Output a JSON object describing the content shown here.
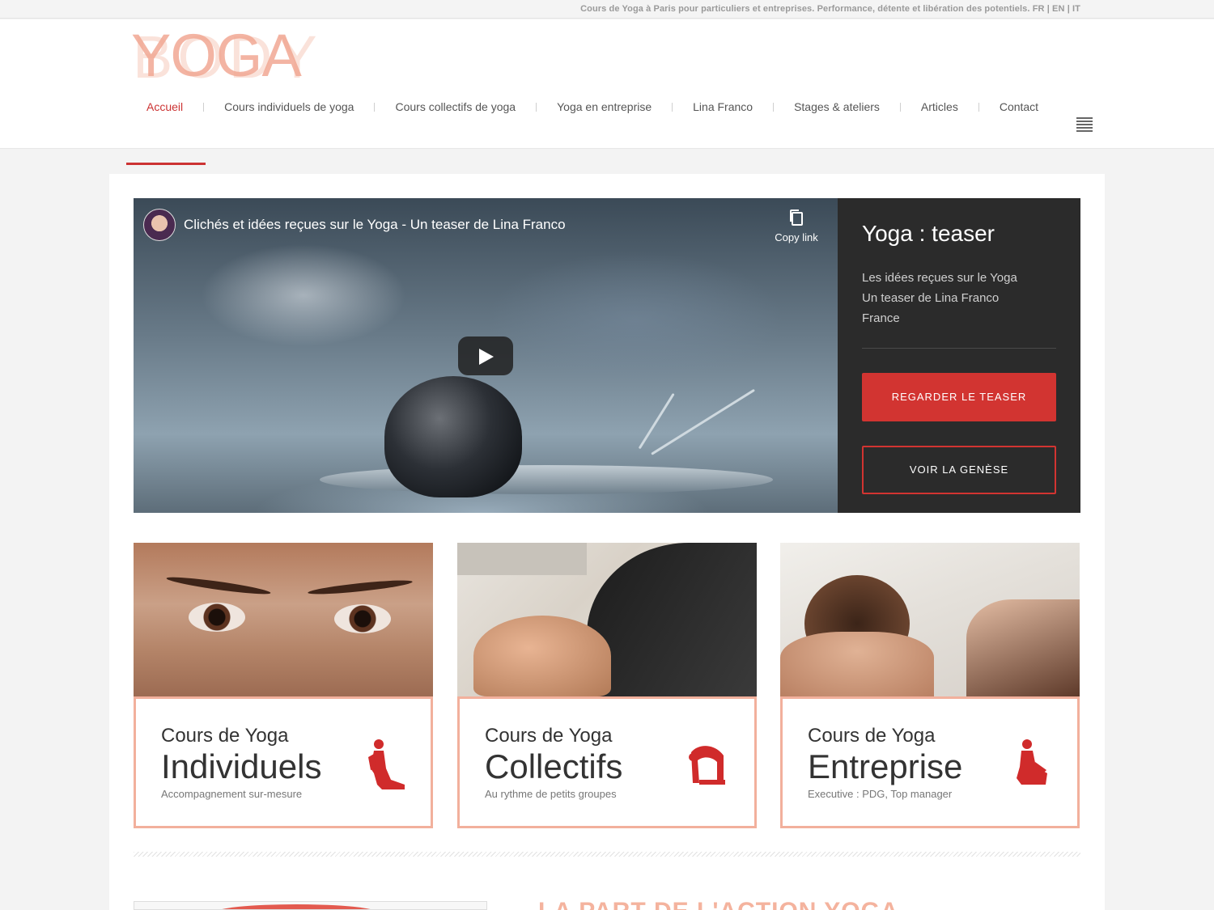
{
  "topbar": {
    "text": "Cours de Yoga à Paris pour particuliers et entreprises. Performance, détente et libération des potentiels. FR | EN | IT"
  },
  "logo": {
    "text": "YOGA",
    "back_text": "BODY"
  },
  "nav": {
    "items": [
      {
        "label": "Accueil",
        "active": true
      },
      {
        "label": "Cours individuels de yoga"
      },
      {
        "label": "Cours collectifs de yoga"
      },
      {
        "label": "Yoga en entreprise"
      },
      {
        "label": "Lina Franco"
      },
      {
        "label": "Stages & ateliers"
      },
      {
        "label": "Articles"
      },
      {
        "label": "Contact"
      }
    ],
    "menu_icon": "menu-icon",
    "accent_color": "#cc3333"
  },
  "video": {
    "title": "Clichés et idées reçues sur le Yoga - Un teaser de Lina Franco",
    "copy_link_label": "Copy link",
    "play_icon": "play-icon"
  },
  "side": {
    "title": "Yoga : teaser",
    "description": [
      "Les idées reçues sur le Yoga",
      "Un teaser de Lina Franco",
      "France"
    ],
    "primary_button": "REGARDER LE TEASER",
    "secondary_button": "VOIR LA GENÈSE",
    "button_color": "#d23431"
  },
  "cards": [
    {
      "pre": "Cours de Yoga",
      "main": "Individuels",
      "sub": "Accompagnement sur-mesure",
      "icon": "yoga-seated-pose-icon"
    },
    {
      "pre": "Cours de Yoga",
      "main": "Collectifs",
      "sub": "Au rythme de petits groupes",
      "icon": "yoga-camel-pose-icon"
    },
    {
      "pre": "Cours de Yoga",
      "main": "Entreprise",
      "sub": "Executive : PDG, Top manager",
      "icon": "yoga-twist-pose-icon"
    }
  ],
  "bottom": {
    "title": "LA PART DE L'ACTION YOGA"
  }
}
